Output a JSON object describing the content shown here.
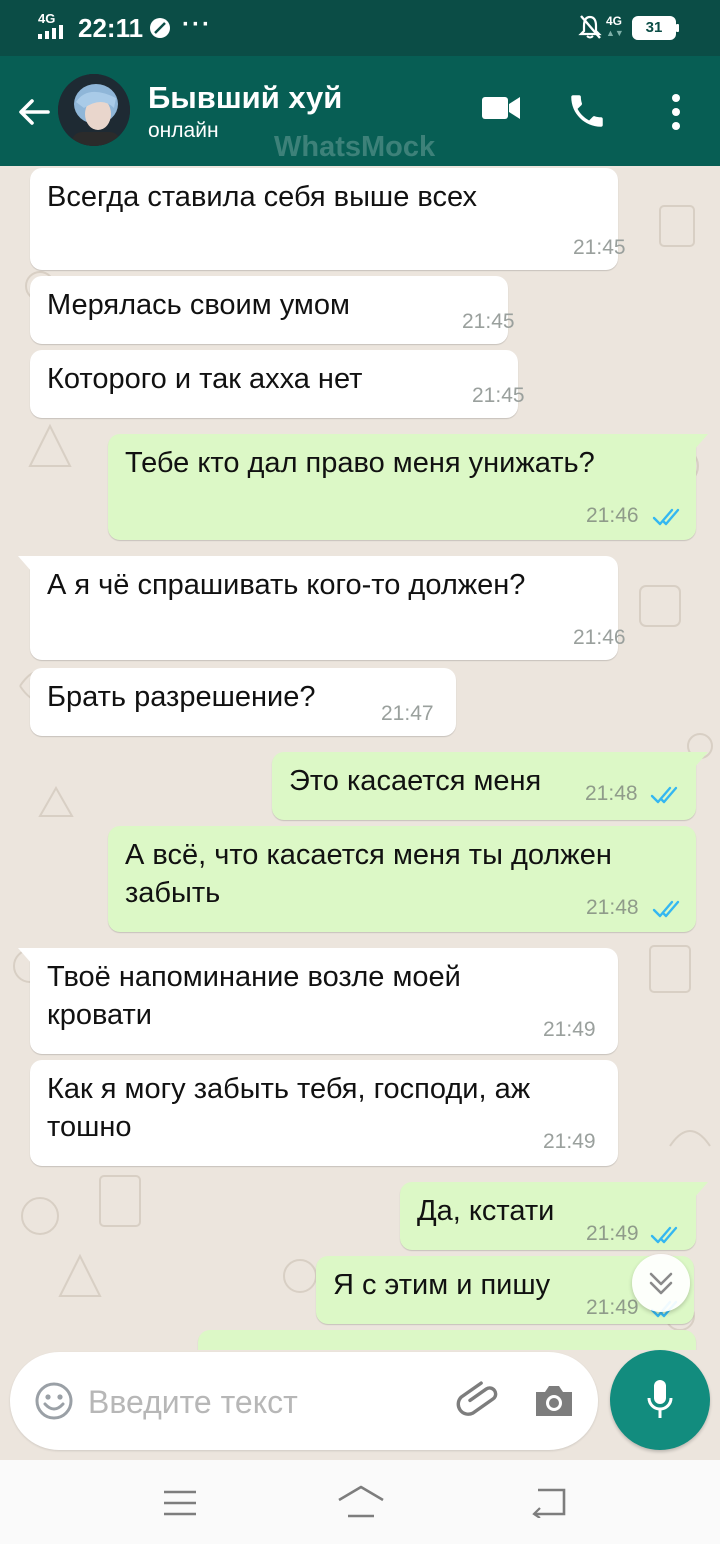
{
  "status_bar": {
    "network_left": "4G",
    "time": "22:11",
    "dots": "···",
    "network_right": "4G",
    "battery": "31"
  },
  "header": {
    "contact_name": "Бывший хуй",
    "status": "онлайн",
    "watermark": "WhatsMock"
  },
  "messages": [
    {
      "direction": "in",
      "text": "Всегда ставила себя выше всех",
      "time": "21:45"
    },
    {
      "direction": "in",
      "text": "Мерялась своим умом",
      "time": "21:45"
    },
    {
      "direction": "in",
      "text": "Которого и так ахха нет",
      "time": "21:45"
    },
    {
      "direction": "out",
      "text": "Тебе кто дал право меня унижать?",
      "time": "21:46",
      "read": true
    },
    {
      "direction": "in",
      "text": "А я чё спрашивать кого-то должен?",
      "time": "21:46"
    },
    {
      "direction": "in",
      "text": "Брать разрешение?",
      "time": "21:47"
    },
    {
      "direction": "out",
      "text": "Это касается меня",
      "time": "21:48",
      "read": true
    },
    {
      "direction": "out",
      "lines": [
        "А всё, что касается меня ты должен",
        "забыть"
      ],
      "time": "21:48",
      "read": true
    },
    {
      "direction": "in",
      "lines": [
        "Твоё напоминание возле моей",
        "кровати"
      ],
      "time": "21:49"
    },
    {
      "direction": "in",
      "lines": [
        "Как я могу забыть тебя, господи, аж",
        "тошно"
      ],
      "time": "21:49"
    },
    {
      "direction": "out",
      "text": "Да, кстати",
      "time": "21:49",
      "read": true
    },
    {
      "direction": "out",
      "text": "Я с этим и пишу",
      "time": "21:49",
      "read": true
    }
  ],
  "input": {
    "placeholder": "Введите текст"
  },
  "colors": {
    "header": "#075e54",
    "status_bar": "#0b4d46",
    "incoming": "#ffffff",
    "outgoing": "#dcf8c6",
    "read_ticks": "#34b7f1",
    "mic_button": "#128c7e"
  },
  "icons": [
    "back-arrow-icon",
    "video-call-icon",
    "phone-icon",
    "more-options-icon",
    "emoji-icon",
    "paperclip-icon",
    "camera-icon",
    "microphone-icon",
    "chevron-down-icon"
  ]
}
